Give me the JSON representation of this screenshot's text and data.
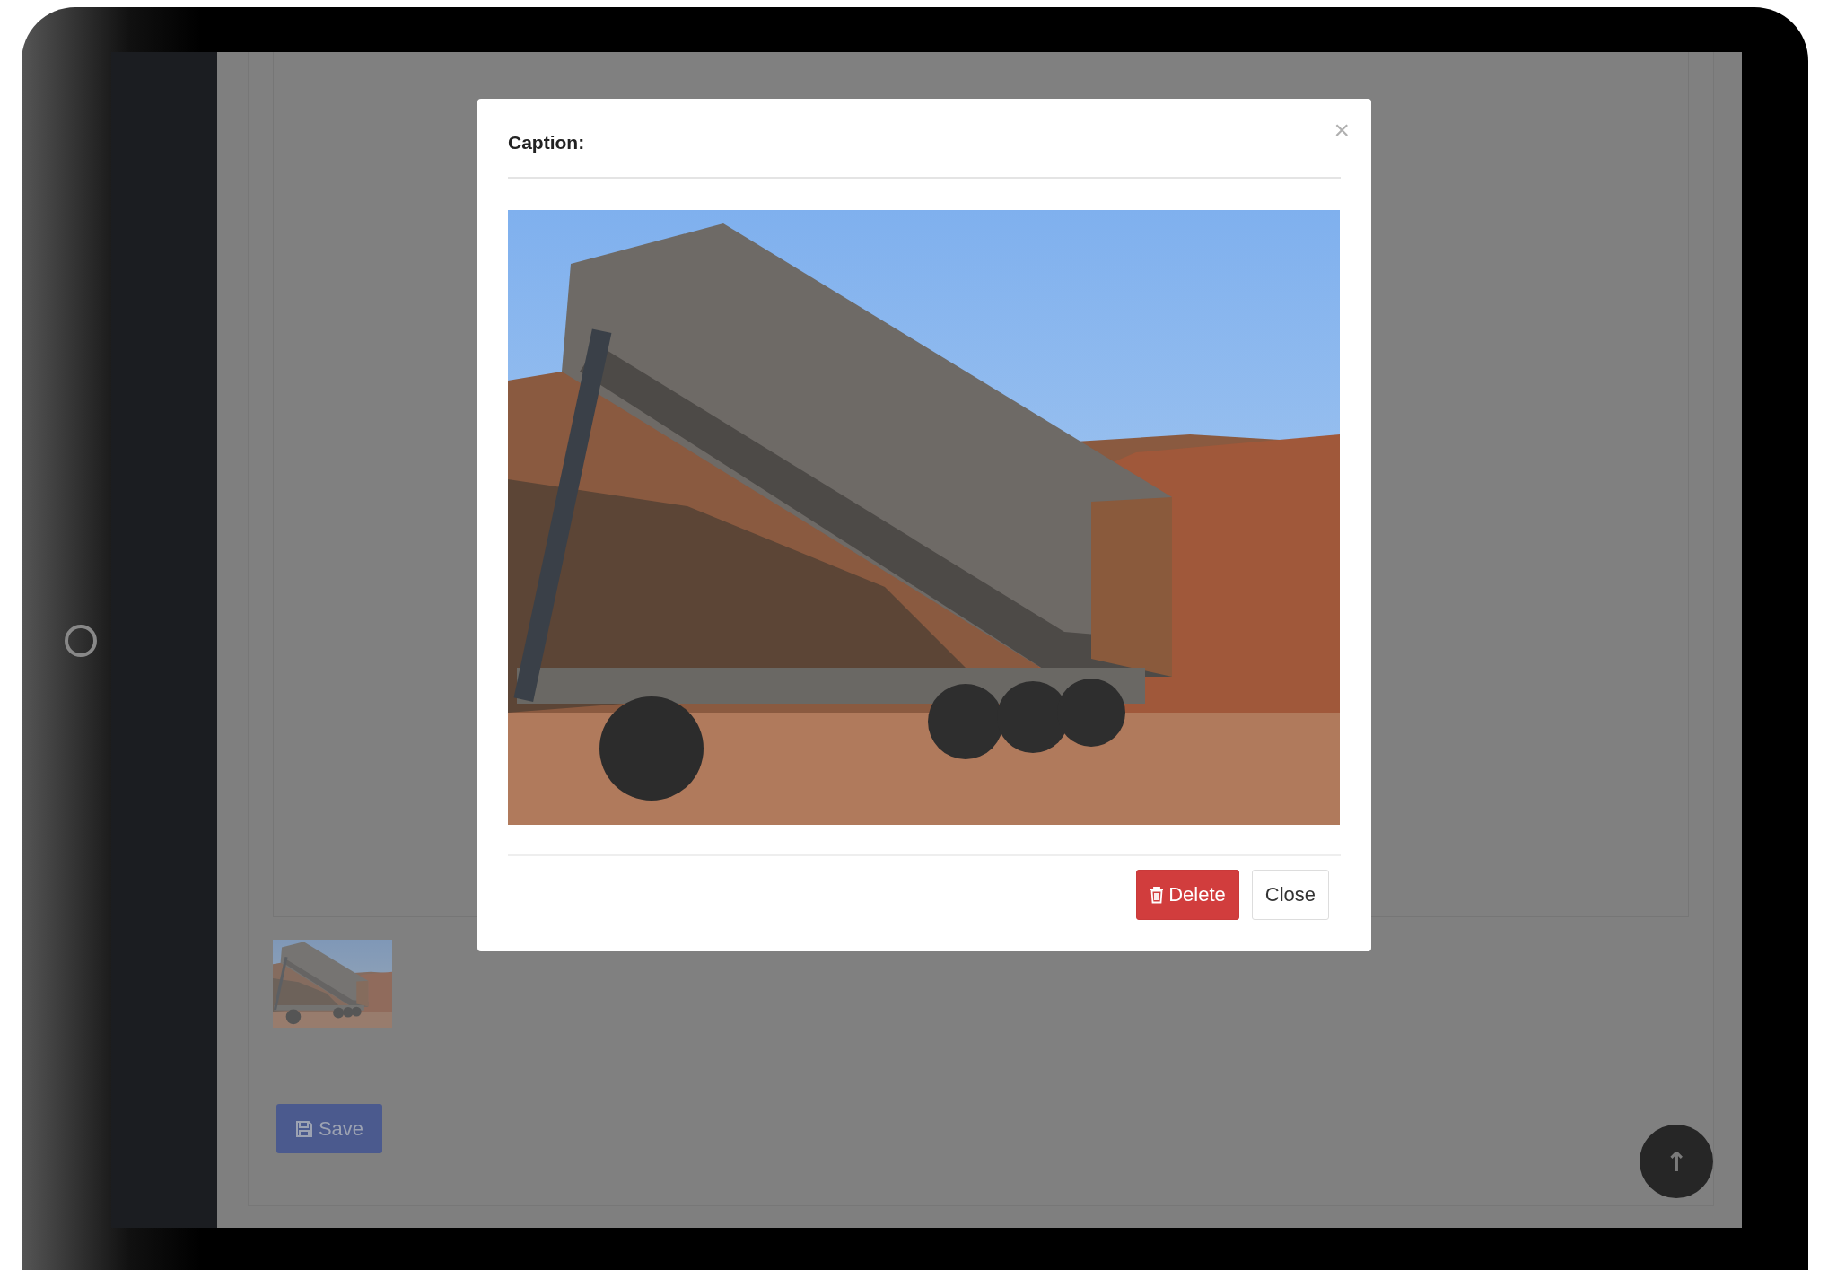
{
  "page": {
    "save_button": {
      "label": "Save"
    },
    "scroll_top_button": {
      "label": "↑"
    }
  },
  "modal": {
    "title": "Caption:",
    "close": "×",
    "buttons": [
      {
        "kind": "danger",
        "label": "Delete"
      },
      {
        "kind": "default",
        "label": "Close"
      }
    ]
  }
}
